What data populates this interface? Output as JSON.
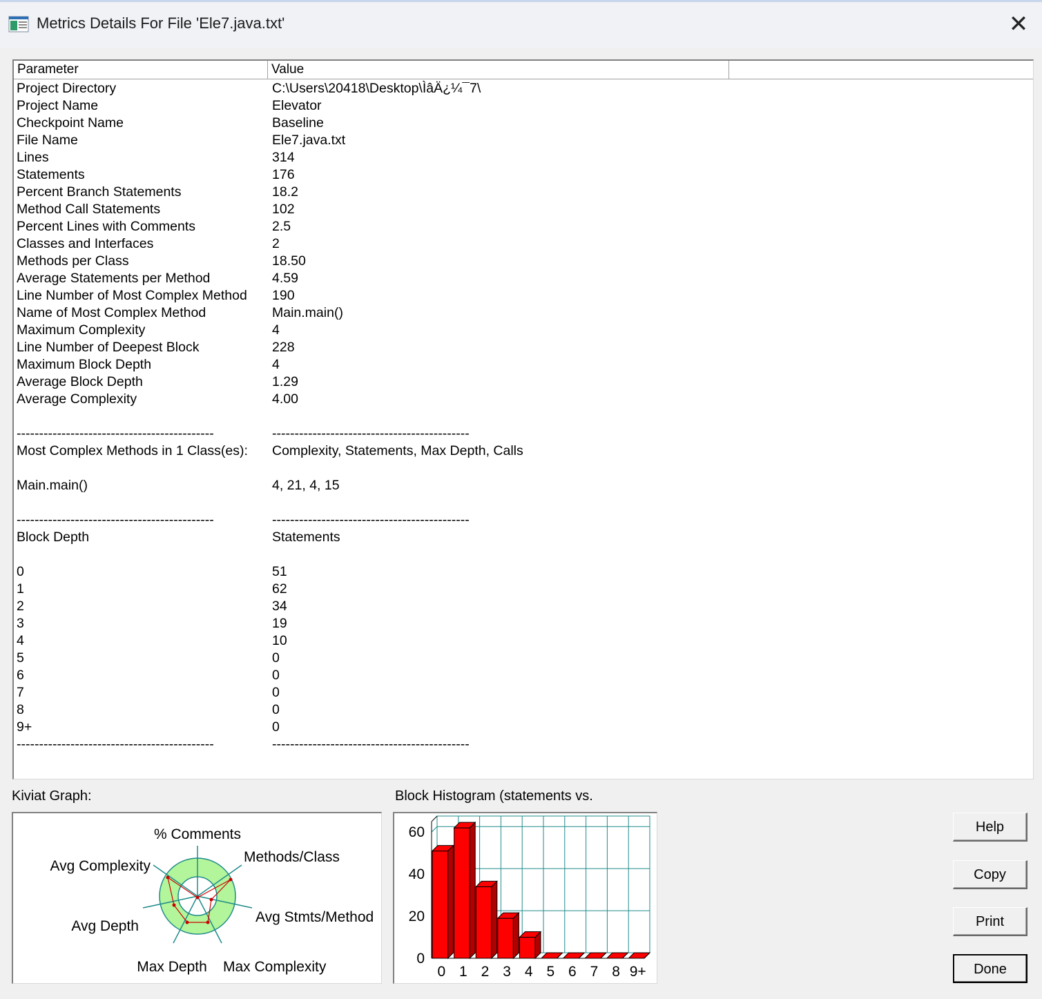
{
  "window": {
    "title": "Metrics Details For File 'Ele7.java.txt'",
    "close_symbol": "✕"
  },
  "table": {
    "headers": [
      "Parameter",
      "Value"
    ],
    "rows": [
      {
        "param": "Project Directory",
        "value": "C:\\Users\\20418\\Desktop\\ÌâÄ¿¼¯7\\"
      },
      {
        "param": "Project Name",
        "value": "Elevator"
      },
      {
        "param": "Checkpoint Name",
        "value": "Baseline"
      },
      {
        "param": "File Name",
        "value": "Ele7.java.txt"
      },
      {
        "param": "Lines",
        "value": "314"
      },
      {
        "param": "Statements",
        "value": "176"
      },
      {
        "param": "Percent Branch Statements",
        "value": "18.2"
      },
      {
        "param": "Method Call Statements",
        "value": "102"
      },
      {
        "param": "Percent Lines with Comments",
        "value": "2.5"
      },
      {
        "param": "Classes and Interfaces",
        "value": "2"
      },
      {
        "param": "Methods per Class",
        "value": "18.50"
      },
      {
        "param": "Average Statements per Method",
        "value": "4.59"
      },
      {
        "param": "Line Number of Most Complex Method",
        "value": "190"
      },
      {
        "param": "Name of Most Complex Method",
        "value": "Main.main()"
      },
      {
        "param": "Maximum Complexity",
        "value": "4"
      },
      {
        "param": "Line Number of Deepest Block",
        "value": "228"
      },
      {
        "param": "Maximum Block Depth",
        "value": "4"
      },
      {
        "param": "Average Block Depth",
        "value": "1.29"
      },
      {
        "param": "Average Complexity",
        "value": "4.00"
      },
      {
        "param": "",
        "value": ""
      },
      {
        "param": "--------------------------------------------",
        "value": "--------------------------------------------"
      },
      {
        "param": "Most Complex Methods in 1 Class(es):",
        "value": "Complexity, Statements, Max Depth, Calls"
      },
      {
        "param": "",
        "value": ""
      },
      {
        "param": "Main.main()",
        "value": "4, 21, 4, 15"
      },
      {
        "param": "",
        "value": ""
      },
      {
        "param": "--------------------------------------------",
        "value": "--------------------------------------------"
      },
      {
        "param": "Block Depth",
        "value": "Statements"
      },
      {
        "param": "",
        "value": ""
      },
      {
        "param": "0",
        "value": "51"
      },
      {
        "param": "1",
        "value": "62"
      },
      {
        "param": "2",
        "value": "34"
      },
      {
        "param": "3",
        "value": "19"
      },
      {
        "param": "4",
        "value": "10"
      },
      {
        "param": "5",
        "value": "0"
      },
      {
        "param": "6",
        "value": "0"
      },
      {
        "param": "7",
        "value": "0"
      },
      {
        "param": "8",
        "value": "0"
      },
      {
        "param": "9+",
        "value": "0"
      },
      {
        "param": "--------------------------------------------",
        "value": "--------------------------------------------"
      }
    ]
  },
  "kiviat": {
    "label": "Kiviat Graph:",
    "axes": [
      "% Comments",
      "Methods/Class",
      "Avg Stmts/Method",
      "Max Complexity",
      "Max Depth",
      "Avg Depth",
      "Avg Complexity"
    ],
    "colors": {
      "band": "#b3f59a",
      "axis": "#1f8a8a",
      "trace": "#cc0000"
    }
  },
  "histogram": {
    "label": "Block Histogram (statements vs.",
    "colors": {
      "bar": "#ff0000",
      "bar_dark": "#b00000",
      "grid": "#1f8a8a"
    }
  },
  "chart_data": {
    "type": "bar",
    "categories": [
      "0",
      "1",
      "2",
      "3",
      "4",
      "5",
      "6",
      "7",
      "8",
      "9+"
    ],
    "values": [
      51,
      62,
      34,
      19,
      10,
      0,
      0,
      0,
      0,
      0
    ],
    "title": "Block Histogram (statements vs.",
    "xlabel": "",
    "ylabel": "",
    "ylim": [
      0,
      65
    ],
    "yticks": [
      0,
      20,
      40,
      60
    ],
    "grid": true
  },
  "buttons": {
    "help": "Help",
    "copy": "Copy",
    "print": "Print",
    "done": "Done"
  }
}
